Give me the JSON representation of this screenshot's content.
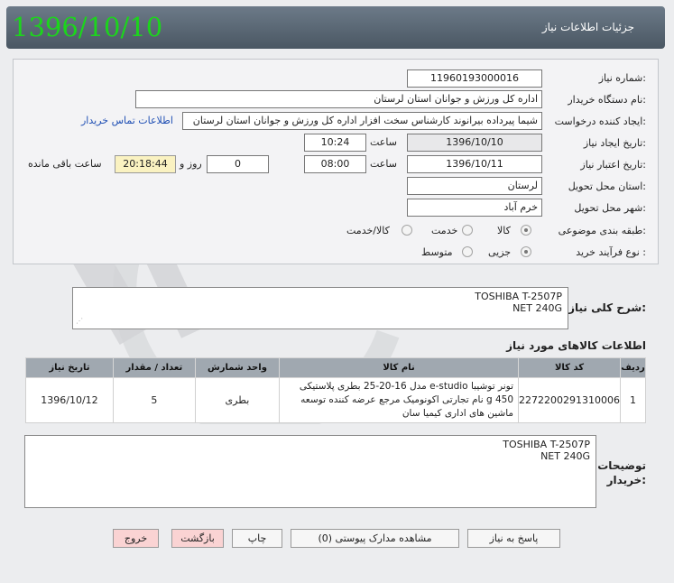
{
  "header": {
    "title": "جزئیات اطلاعات نیاز",
    "date": "1396/10/10"
  },
  "form": {
    "need_number_label": "شماره نیاز:",
    "need_number": "1196019300001‌6",
    "buyer_org_label": "نام دستگاه خریدار:",
    "buyer_org": "اداره کل ورزش و جوانان استان لرستان",
    "requester_label": "ایجاد کننده درخواست:",
    "requester": "شیما پیرداده بیرانوند کارشناس سخت افزار اداره کل ورزش و جوانان استان لرستان",
    "contact_link": "اطلاعات تماس خریدار",
    "created_label": "تاریخ ایجاد نیاز:",
    "created_date": "1396/10/10",
    "created_time_label": "ساعت",
    "created_time": "10:24",
    "validity_label": "تاریخ اعتبار نیاز:",
    "validity_date": "1396/10/11",
    "validity_time_label": "ساعت",
    "validity_time": "08:00",
    "days_value": "0",
    "days_label": "روز و",
    "remaining_time": "20:18:44",
    "remaining_label": "ساعت باقی مانده",
    "province_label": "استان محل تحویل:",
    "province": "لرستان",
    "city_label": "شهر محل تحویل:",
    "city": "خرم آباد",
    "category_label": "طبقه بندی موضوعی:",
    "category_options": [
      "کالا",
      "خدمت",
      "کالا/خدمت"
    ],
    "category_selected": "کالا",
    "process_label": "نوع فرآیند خرید :",
    "process_options": [
      "جزیی",
      "متوسط"
    ],
    "process_selected": "جزیی"
  },
  "general_desc": {
    "label": "شرح کلی نیاز:",
    "line1": "TOSHIBA T-2507P",
    "line2": "NET 240G"
  },
  "items_section_title": "اطلاعات کالاهای مورد نیاز",
  "items_table": {
    "headers": [
      "ردیف",
      "کد کالا",
      "نام کالا",
      "واحد شمارش",
      "تعداد / مقدار",
      "تاریخ نیاز"
    ],
    "rows": [
      {
        "row": "1",
        "code": "2272200291310006",
        "name": "تونر توشیبا e-studio مدل 16-20-25 بطری پلاستیکی 450 g نام تجارتی اکونومیک مرجع عرضه کننده توسعه ماشین های اداری کیمیا سان",
        "unit": "بطری",
        "qty": "5",
        "date": "1396/10/12"
      }
    ]
  },
  "buyer_notes": {
    "label_line1": "توضیحات",
    "label_line2": "خریدار:",
    "line1": "TOSHIBA T-2507P",
    "line2": "NET 240G"
  },
  "buttons": {
    "reply": "پاسخ به نیاز",
    "attachments": "مشاهده مدارک پیوستی (0)",
    "print": "چاپ",
    "back": "بازگشت",
    "exit": "خروج"
  },
  "colors": {
    "header_bg": "#56626e",
    "date_green": "#1cd51c",
    "exit_red": "#fad3d3"
  }
}
